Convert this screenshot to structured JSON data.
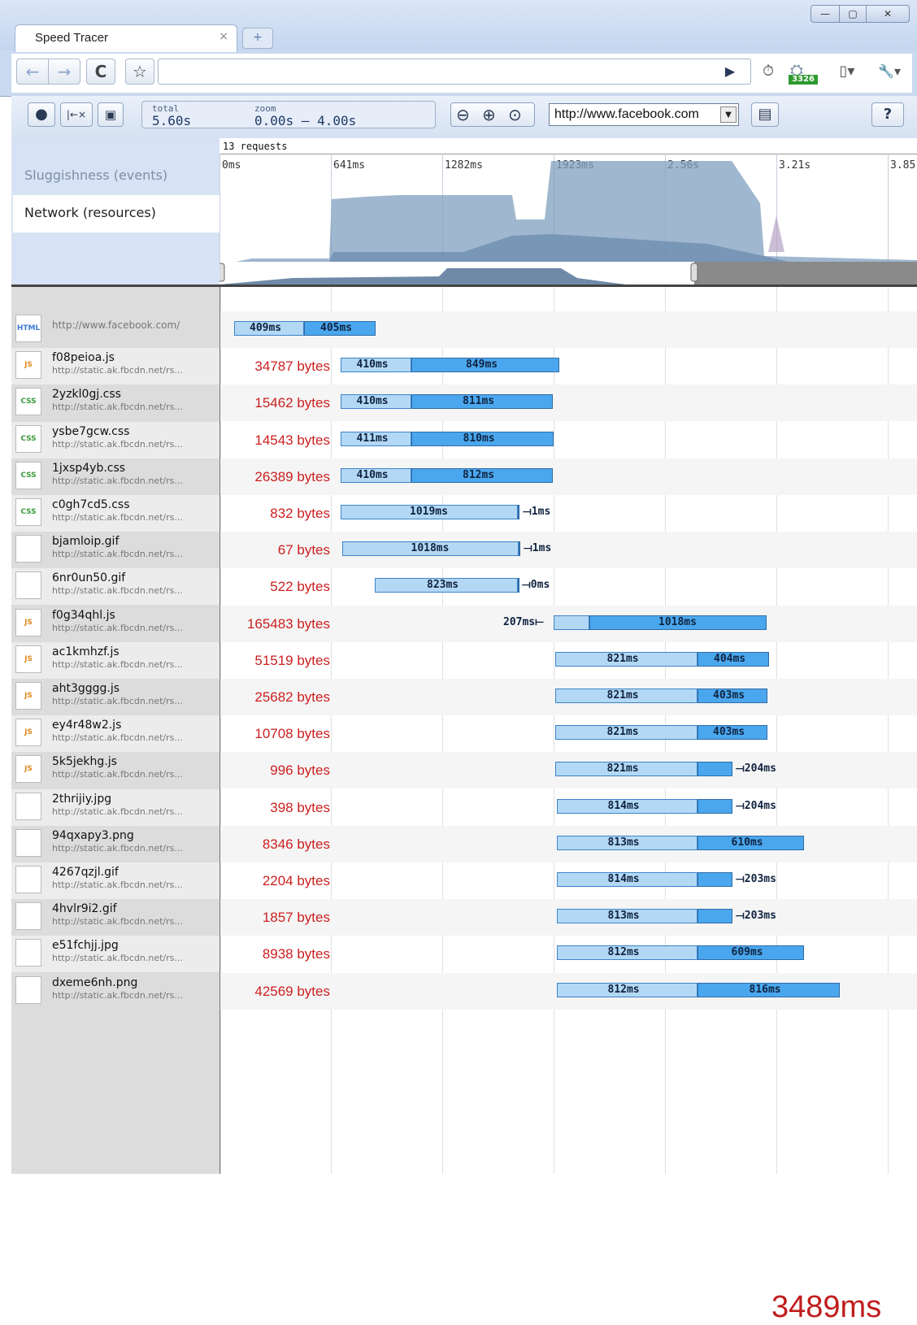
{
  "window": {
    "tab_title": "Speed Tracer",
    "tab_close": "×",
    "newtab": "+",
    "minimize": "—",
    "maximize": "▢",
    "close": "✕"
  },
  "browser": {
    "back": "←",
    "forward": "→",
    "reload": "C",
    "star": "☆",
    "play": "▶",
    "badge_count": "3326",
    "page_menu": "▯▾",
    "wrench_menu": "🔧▾"
  },
  "speedtracer": {
    "record": "●",
    "clear": "|←×",
    "save": "▣",
    "total_label": "total",
    "total_value": "5.60s",
    "zoom_label": "zoom",
    "zoom_value": "0.00s – 4.00s",
    "zoom_out": "⊖",
    "zoom_in": "⊕",
    "zoom_reset": "⊙",
    "url": "http://www.facebook.com",
    "report": "▤",
    "help": "?"
  },
  "overview": {
    "sluggishness_tab": "Sluggishness (events)",
    "network_tab": "Network (resources)",
    "request_count": "13 requests",
    "ticks": [
      "0ms",
      "641ms",
      "1282ms",
      "1923ms",
      "2.56s",
      "3.21s",
      "3.85"
    ]
  },
  "resources": [
    {
      "icon": "HTML",
      "name": "",
      "url": "http://www.facebook.com/",
      "bytes": "",
      "wait": "409ms",
      "recv": "405ms",
      "start": 17,
      "wait_w": 86,
      "recv_w": 88
    },
    {
      "icon": "JS",
      "name": "f08peioa.js",
      "url": "http://static.ak.fbcdn.net/rs...",
      "bytes": "34787 bytes",
      "wait": "410ms",
      "recv": "849ms",
      "start": 148,
      "wait_w": 87,
      "recv_w": 182
    },
    {
      "icon": "CSS",
      "name": "2yzkl0gj.css",
      "url": "http://static.ak.fbcdn.net/rs...",
      "bytes": "15462 bytes",
      "wait": "410ms",
      "recv": "811ms",
      "start": 148,
      "wait_w": 87,
      "recv_w": 174
    },
    {
      "icon": "CSS",
      "name": "ysbe7gcw.css",
      "url": "http://static.ak.fbcdn.net/rs...",
      "bytes": "14543 bytes",
      "wait": "411ms",
      "recv": "810ms",
      "start": 148,
      "wait_w": 87,
      "recv_w": 175
    },
    {
      "icon": "CSS",
      "name": "1jxsp4yb.css",
      "url": "http://static.ak.fbcdn.net/rs...",
      "bytes": "26389 bytes",
      "wait": "410ms",
      "recv": "812ms",
      "start": 148,
      "wait_w": 87,
      "recv_w": 174
    },
    {
      "icon": "CSS",
      "name": "c0gh7cd5.css",
      "url": "http://static.ak.fbcdn.net/rs...",
      "bytes": "832 bytes",
      "wait": "1019ms",
      "recv": "1ms",
      "start": 148,
      "wait_w": 218,
      "recv_w": 2
    },
    {
      "icon": "",
      "name": "bjamloip.gif",
      "url": "http://static.ak.fbcdn.net/rs...",
      "bytes": "67 bytes",
      "wait": "1018ms",
      "recv": "1ms",
      "start": 150,
      "wait_w": 217,
      "recv_w": 2
    },
    {
      "icon": "",
      "name": "6nr0un50.gif",
      "url": "http://static.ak.fbcdn.net/rs...",
      "bytes": "522 bytes",
      "wait": "823ms",
      "recv": "0ms",
      "start": 190,
      "wait_w": 176,
      "recv_w": 1
    },
    {
      "icon": "JS",
      "name": "f0g34qhl.js",
      "url": "http://static.ak.fbcdn.net/rs...",
      "bytes": "165483 bytes",
      "wait": "207ms",
      "recv": "1018ms",
      "start": 410,
      "wait_w": 44,
      "recv_w": 218
    },
    {
      "icon": "JS",
      "name": "ac1kmhzf.js",
      "url": "http://static.ak.fbcdn.net/rs...",
      "bytes": "51519 bytes",
      "wait": "821ms",
      "recv": "404ms",
      "start": 412,
      "wait_w": 175,
      "recv_w": 88
    },
    {
      "icon": "JS",
      "name": "aht3gggg.js",
      "url": "http://static.ak.fbcdn.net/rs...",
      "bytes": "25682 bytes",
      "wait": "821ms",
      "recv": "403ms",
      "start": 412,
      "wait_w": 175,
      "recv_w": 86
    },
    {
      "icon": "JS",
      "name": "ey4r48w2.js",
      "url": "http://static.ak.fbcdn.net/rs...",
      "bytes": "10708 bytes",
      "wait": "821ms",
      "recv": "403ms",
      "start": 412,
      "wait_w": 175,
      "recv_w": 86
    },
    {
      "icon": "JS",
      "name": "5k5jekhg.js",
      "url": "http://static.ak.fbcdn.net/rs...",
      "bytes": "996 bytes",
      "wait": "821ms",
      "recv": "204ms",
      "start": 412,
      "wait_w": 175,
      "recv_w": 43
    },
    {
      "icon": "",
      "name": "2thrijiy.jpg",
      "url": "http://static.ak.fbcdn.net/rs...",
      "bytes": "398 bytes",
      "wait": "814ms",
      "recv": "204ms",
      "start": 414,
      "wait_w": 173,
      "recv_w": 43
    },
    {
      "icon": "",
      "name": "94qxapy3.png",
      "url": "http://static.ak.fbcdn.net/rs...",
      "bytes": "8346 bytes",
      "wait": "813ms",
      "recv": "610ms",
      "start": 414,
      "wait_w": 173,
      "recv_w": 131
    },
    {
      "icon": "",
      "name": "4267qzjl.gif",
      "url": "http://static.ak.fbcdn.net/rs...",
      "bytes": "2204 bytes",
      "wait": "814ms",
      "recv": "203ms",
      "start": 414,
      "wait_w": 173,
      "recv_w": 43
    },
    {
      "icon": "",
      "name": "4hvlr9i2.gif",
      "url": "http://static.ak.fbcdn.net/rs...",
      "bytes": "1857 bytes",
      "wait": "813ms",
      "recv": "203ms",
      "start": 414,
      "wait_w": 173,
      "recv_w": 43
    },
    {
      "icon": "",
      "name": "e51fchjj.jpg",
      "url": "http://static.ak.fbcdn.net/rs...",
      "bytes": "8938 bytes",
      "wait": "812ms",
      "recv": "609ms",
      "start": 414,
      "wait_w": 173,
      "recv_w": 131
    },
    {
      "icon": "",
      "name": "dxeme6nh.png",
      "url": "http://static.ak.fbcdn.net/rs...",
      "bytes": "42569 bytes",
      "wait": "812ms",
      "recv": "816ms",
      "start": 414,
      "wait_w": 173,
      "recv_w": 175
    }
  ],
  "total_time": "3489ms",
  "colors": {
    "accent": "#4aa7ee",
    "wait": "#b3d8f5",
    "bytes": "#cc1f1f"
  }
}
